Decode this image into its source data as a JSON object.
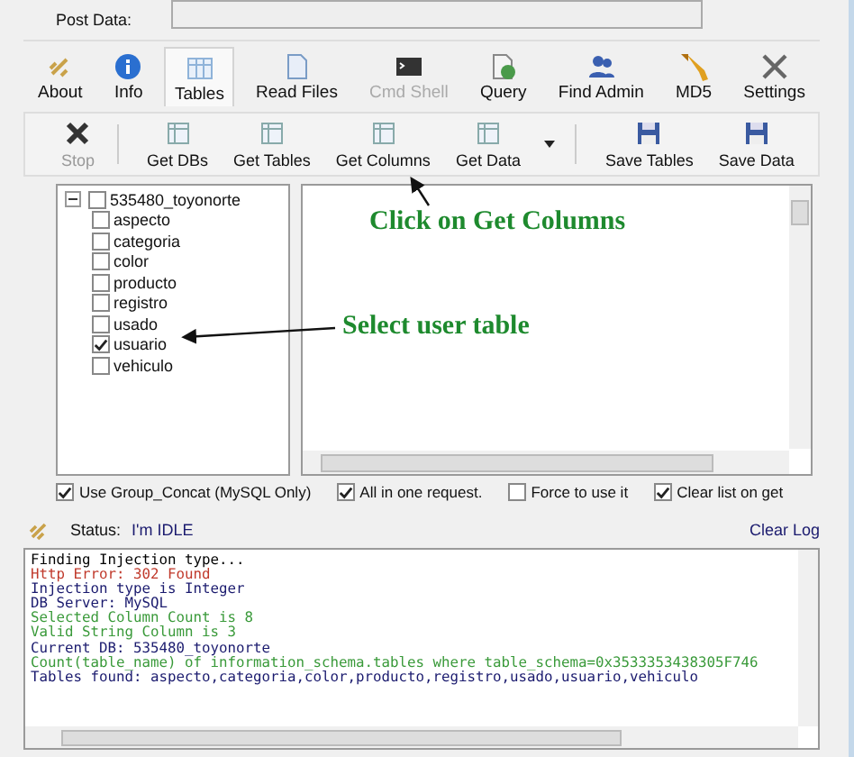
{
  "post_data": {
    "label": "Post Data:"
  },
  "tabs": [
    {
      "label": "About",
      "selected": false,
      "disabled": false
    },
    {
      "label": "Info",
      "selected": false,
      "disabled": false
    },
    {
      "label": "Tables",
      "selected": true,
      "disabled": false
    },
    {
      "label": "Read Files",
      "selected": false,
      "disabled": false
    },
    {
      "label": "Cmd Shell",
      "selected": false,
      "disabled": true
    },
    {
      "label": "Query",
      "selected": false,
      "disabled": false
    },
    {
      "label": "Find Admin",
      "selected": false,
      "disabled": false
    },
    {
      "label": "MD5",
      "selected": false,
      "disabled": false
    },
    {
      "label": "Settings",
      "selected": false,
      "disabled": false
    }
  ],
  "toolbar": [
    {
      "label": "Stop",
      "disabled": true
    },
    {
      "label": "Get DBs",
      "disabled": false
    },
    {
      "label": "Get Tables",
      "disabled": false
    },
    {
      "label": "Get Columns",
      "disabled": false
    },
    {
      "label": "Get Data",
      "disabled": false,
      "dropdown": true
    },
    {
      "label": "Save Tables",
      "disabled": false
    },
    {
      "label": "Save Data",
      "disabled": false
    }
  ],
  "tree": {
    "label": "535480_toyonorte",
    "checked": false,
    "expanded": true,
    "children": [
      {
        "label": "aspecto",
        "checked": false
      },
      {
        "label": "categoria",
        "checked": false
      },
      {
        "label": "color",
        "checked": false
      },
      {
        "label": "producto",
        "checked": false
      },
      {
        "label": "registro",
        "checked": false
      },
      {
        "label": "usado",
        "checked": false
      },
      {
        "label": "usuario",
        "checked": true
      },
      {
        "label": "vehiculo",
        "checked": false
      }
    ]
  },
  "options": [
    {
      "label": "Use Group_Concat (MySQL Only)",
      "checked": true
    },
    {
      "label": "All in one request.",
      "checked": true
    },
    {
      "label": "Force to use it",
      "checked": false
    },
    {
      "label": "Clear list on get",
      "checked": true
    }
  ],
  "status": {
    "label": "Status:",
    "value": "I'm IDLE",
    "clear_log": "Clear Log"
  },
  "log": [
    {
      "text": "Finding Injection type...",
      "color": "#000000"
    },
    {
      "text": "Http Error: 302 Found",
      "color": "#c0392b"
    },
    {
      "text": "Injection type is Integer",
      "color": "#1a1a6e"
    },
    {
      "text": "DB Server: MySQL",
      "color": "#1a1a6e"
    },
    {
      "text": "Selected Column Count is 8",
      "color": "#3a9a3a"
    },
    {
      "text": "Valid String Column is 3",
      "color": "#3a9a3a"
    },
    {
      "text": "Current DB: 535480_toyonorte",
      "color": "#1a1a6e"
    },
    {
      "text": "Count(table_name) of information_schema.tables where table_schema=0x3533353438305F746",
      "color": "#3a9a3a"
    },
    {
      "text": "Tables found: aspecto,categoria,color,producto,registro,usado,usuario,vehiculo",
      "color": "#1a1a6e"
    }
  ],
  "annotations": [
    {
      "text": "Click on Get Columns"
    },
    {
      "text": "Select user table"
    }
  ]
}
